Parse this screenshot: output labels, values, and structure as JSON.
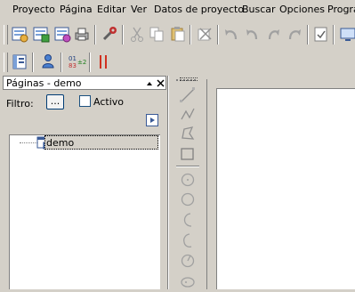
{
  "menu": [
    {
      "label": "Proyecto"
    },
    {
      "label": "Página"
    },
    {
      "label": "Editar"
    },
    {
      "label": "Ver"
    },
    {
      "label": "Datos de proyecto"
    },
    {
      "label": "Buscar"
    },
    {
      "label": "Opciones"
    },
    {
      "label": "Progra"
    }
  ],
  "panel": {
    "title": "Páginas - demo",
    "filter_label": "Filtro:",
    "filter_button": "...",
    "active_label": "Activo",
    "active_checked": false
  },
  "tree": {
    "items": [
      {
        "label": "demo",
        "selected": true
      }
    ]
  },
  "icons": {
    "toolbar1": [
      "open-project-icon",
      "new-project-icon",
      "print-preview-icon",
      "print-icon",
      "tools-icon",
      "cut-icon",
      "copy-icon",
      "paste-icon",
      "delete-icon",
      "undo-icon",
      "undo-step-icon",
      "redo-step-icon",
      "redo-icon",
      "check-icon",
      "monitor-icon"
    ],
    "toolbar2": [
      "page-view-icon",
      "user-icon",
      "numbering-icon",
      "red-bars-icon"
    ],
    "vertical": [
      "line-tool-icon",
      "polyline-tool-icon",
      "polygon-tool-icon",
      "rectangle-tool-icon",
      "circle-center-icon",
      "circle-icon",
      "arc-icon",
      "arc-reverse-icon",
      "ellipse-arc-icon",
      "ellipse-icon"
    ]
  },
  "colors": {
    "window_bg": "#d4d0c8",
    "selection_bg": "#d4d0c8",
    "checkbox_border": "#1c5180"
  }
}
